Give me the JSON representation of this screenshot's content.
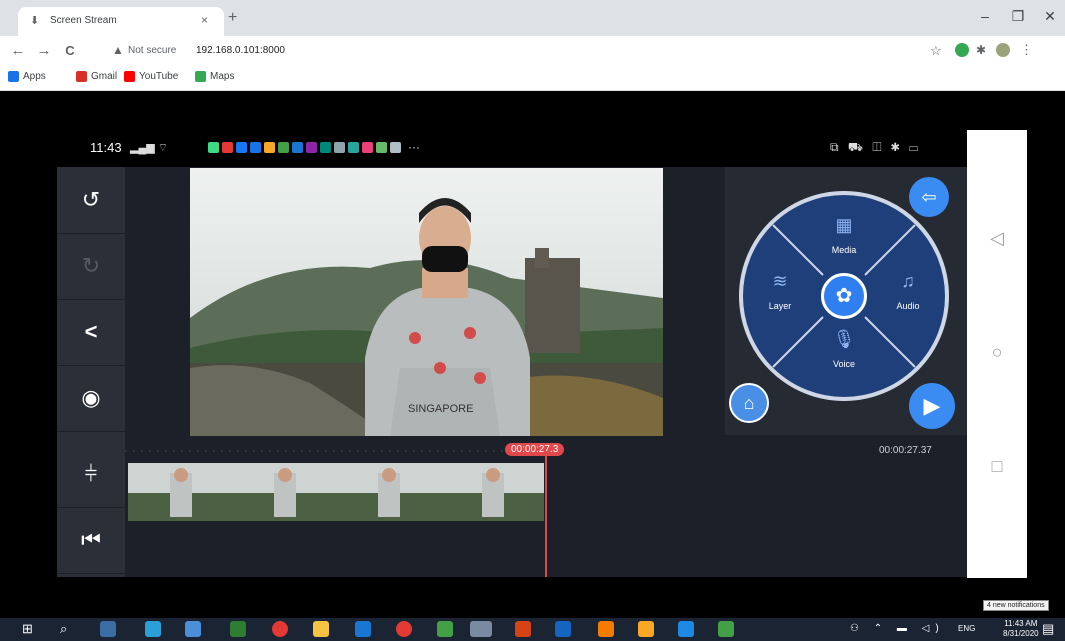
{
  "browser": {
    "tab_title": "Screen Stream",
    "tab_close": "×",
    "new_tab": "+",
    "window_controls": {
      "minimize": "–",
      "maximize": "❐",
      "close": "✕"
    },
    "nav": {
      "back": "←",
      "forward": "→",
      "reload": "C"
    },
    "security_label": "Not secure",
    "url": "192.168.0.101:8000",
    "bookmarks": [
      {
        "label": "Apps",
        "icon": "apps-icon",
        "color": "#1a73e8"
      },
      {
        "label": "Gmail",
        "icon": "gmail-icon",
        "color": "#d93025"
      },
      {
        "label": "YouTube",
        "icon": "youtube-icon",
        "color": "#ff0000"
      },
      {
        "label": "Maps",
        "icon": "maps-icon",
        "color": "#34a853"
      }
    ]
  },
  "phone": {
    "clock": "11:43",
    "status_more": "···",
    "sys_icons": "⧉ ⛟ ◫ ✱ ▭"
  },
  "editor": {
    "left_tools": [
      {
        "name": "undo-button",
        "icon": "↺"
      },
      {
        "name": "redo-button",
        "icon": "↻"
      },
      {
        "name": "share-button",
        "icon": "<"
      },
      {
        "name": "capture-button",
        "icon": "◉"
      },
      {
        "name": "split-button",
        "icon": "⫩"
      },
      {
        "name": "rewind-button",
        "icon": "⏮"
      }
    ],
    "playhead_time": "00:00:27.3",
    "end_time": "00:00:27.37",
    "clip_frames": 4,
    "preview_caption": "SINGAPORE",
    "wheel": {
      "media": "Media",
      "audio": "Audio",
      "voice": "Voice",
      "layer": "Layer"
    }
  },
  "taskbar": {
    "time": "11:43 AM",
    "date": "8/31/2020",
    "lang": "ENG",
    "notification": "4 new notifications"
  },
  "colors": {
    "accent": "#3b8cf2",
    "playhead": "#e0484b",
    "wheel": "#1f3f7a"
  }
}
